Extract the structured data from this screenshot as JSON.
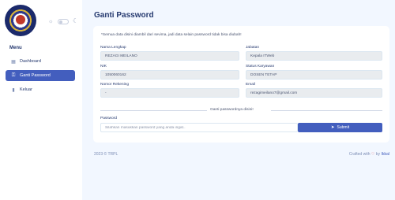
{
  "sidebar": {
    "menu_title": "Menu",
    "items": [
      {
        "label": "Dashboard",
        "icon": "grid-icon"
      },
      {
        "label": "Ganti Password",
        "icon": "key-icon",
        "active": true
      },
      {
        "label": "Keluar",
        "icon": "trash-icon"
      }
    ]
  },
  "page": {
    "title": "Ganti Password"
  },
  "card": {
    "note": "*Semua data disini diambil dari sevima, jadi data selain password tidak bisa diubah!",
    "fields": {
      "nama": {
        "label": "Nama Lengkap",
        "value": "REZAGI MEILANO"
      },
      "jabatan": {
        "label": "Jabatan",
        "value": "Kepala ITWeb"
      },
      "nik": {
        "label": "NIK",
        "value": "1050060162"
      },
      "status": {
        "label": "Status Karyawan",
        "value": "DOSEN TETAP"
      },
      "rekening": {
        "label": "Nomor Rekening",
        "value": "-"
      },
      "email": {
        "label": "Email",
        "value": "rezagimeilano7@gmail.com"
      }
    },
    "divider_text": "Ganti passwordnya disini!",
    "password": {
      "label": "Password",
      "placeholder": "Silahkan masukkan password yang anda ingat..",
      "value": ""
    },
    "submit_label": "Submit"
  },
  "footer": {
    "left": "2023 © TRPL",
    "right_prefix": "Crafted with",
    "right_by": "by",
    "right_link": "Ikbal"
  },
  "colors": {
    "primary": "#435ebe",
    "background": "#f2f7ff",
    "heart": "#e25555"
  }
}
